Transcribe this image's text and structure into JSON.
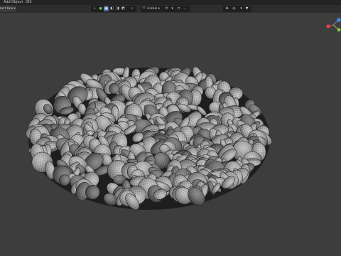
{
  "menu": {
    "items": [
      "Add",
      "Object",
      "GIS"
    ]
  },
  "header": {
    "mode_dropdown": "lect Box ▾",
    "orientation_label": "Global ▾",
    "orientation_icon": "transform-orientation-icon",
    "pivot_icon": "pivot-point-icon",
    "snap_icon": "magnet-icon",
    "proportional_icon": "proportional-edit-icon",
    "overlay_icon": "overlay-icon",
    "gizmo_toggle_icon": "gizmo-toggle-icon"
  },
  "navigation_gizmo": {
    "x_label": "X",
    "y_label": "Y",
    "z_label": "Z",
    "colors": {
      "x": "#e8424f",
      "y": "#8ec63f",
      "z": "#4a8ee6"
    }
  },
  "viewport": {
    "background": "#3d3d3d",
    "object": "pile-of-spherical-caps-mesh"
  }
}
